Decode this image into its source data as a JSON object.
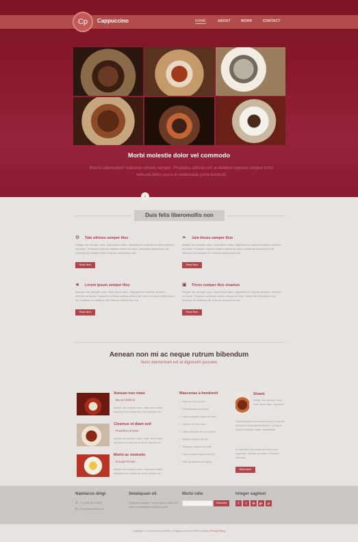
{
  "brand": {
    "logo": "Cp",
    "name": "Cappuccino"
  },
  "nav": [
    "Home",
    "About",
    "Work",
    "Contact"
  ],
  "hero": {
    "title": "Morbi molestie dolor vel commodo",
    "text": "Mauris ullamcorper vulputate ultrices semper. Phasellus ultricies elit at eleifend egestas congue tortor vehicula tellus purus in malesuada porta tincidunt."
  },
  "features": {
    "title": "Duis felis liberomollis non",
    "items": [
      {
        "icon": "gear-icon",
        "title": "Tate ultrices semper illus",
        "text": "Integer nec semper nunc. Nam lacus diam, dignissim eu lobortis sit amet, ultricies vel tortor. Praesent vehicula massa ultrices at dolor commodo elementum vel. Quisque se tristique elitm. Duis ac elementum dui.",
        "button": "Read More"
      },
      {
        "icon": "leaf-icon",
        "title": "Join tinces semper illus",
        "text": "Integer nec semper nunc. Nam lacus diam, dignissim eu lobortis sit amet, ultricies vel tortor. Praesent ultrices massa ultrices at dolor commodo elementum vel. Quisque se tristique elit. Duis ac elementum dui.",
        "button": "Read More"
      },
      {
        "icon": "trophy-icon",
        "title": "Lorem ipsum semper illus",
        "text": "Aliquam nec semper nunc. Nam lacus diam, dignissim eu lobortis sit amet, ultricies vel tortor. Praesent vehicula massa ultrices at dolor commodo elementum vel. Quisque se tristique elit. Duis ac elementum dui.",
        "button": "Read More"
      },
      {
        "icon": "gift-icon",
        "title": "Trices semper illus vivamus",
        "text": "Integer nec semper nunc. Nam lacus diam, dignissim eu lobortis sit amet, ultricies vel tortor. Praesent vehicula massa ultrices at dolor commodo elementum vel. Quisque se tristique elit. Duis ac elementum dui.",
        "button": "Read More"
      }
    ]
  },
  "section2": {
    "title": "Aenean non mi ac neque rutrum bibendum",
    "subtitle": "Nunc elementum est at dignissim posuere",
    "posts": [
      {
        "title": "Aenean non mian",
        "sub": "- Mauris eleifend",
        "text": "Integer nec semper nunc. Nam lacus diam, dignissim eu lobortis sit amet ultricies vel."
      },
      {
        "title": "Cleamus et diam sed",
        "sub": "- Phasellus sit amet",
        "text": "Integer nec semper nunc. Nam lacus diam, dignissim eu lobortis sit amet ultricies vel."
      },
      {
        "title": "Morbi ac molestie",
        "sub": "- Suscipit fermen",
        "text": "Integer nec semper nunc. Nam lacus diam, dignissim eu lobortis sit amet ultricies vel."
      }
    ],
    "list": {
      "title": "Maecenas a hendrerit",
      "items": [
        "Nunc at orci ut quis",
        "Pellentesque sed tortor",
        "Donec egestas diam sed nibh",
        "Integer vel felis urna",
        "Cras vehicula nunc sed urna",
        "Nullam ultricies nisl id",
        "Aliquam a sapien id pede",
        "Donec sapien diam sed nibh",
        "Duis ac elementum ligula"
      ]
    },
    "side": {
      "title": "Sioani",
      "sub": "Integer nec semper nunc. Nam lacus diam, dignissim.",
      "text1": "Donec lacinia sem a nisl tempor vel iaculis sed lorem vehicula elementum. Quisque ultricies porttitor augue elementum.",
      "text2": "At nisl dui in accumsan at lorem arcu dignissim, ultricies vel tortor. Praesent vehicula.",
      "button": "Read More"
    }
  },
  "footer": {
    "cols": [
      {
        "title": "Namlacus dingi",
        "lines": [
          "+1 (111) 323 5433",
          "info@demolink.com"
        ]
      },
      {
        "title": "Setaliquam oli",
        "lines": [
          "Nulla scelerisque. Lorem ipsum dolor sit",
          "amet, consectetur adipiscing elit."
        ]
      },
      {
        "title": "Morbi odio",
        "button": "Subscribe"
      },
      {
        "title": "Integer sagitest",
        "social": [
          "f",
          "t",
          "in",
          "g+",
          "p"
        ]
      }
    ],
    "copyright": "Copyright © 2015 Company Name. All rights reserved. Web Templates",
    "copyright_link": "Privacy Policy"
  }
}
